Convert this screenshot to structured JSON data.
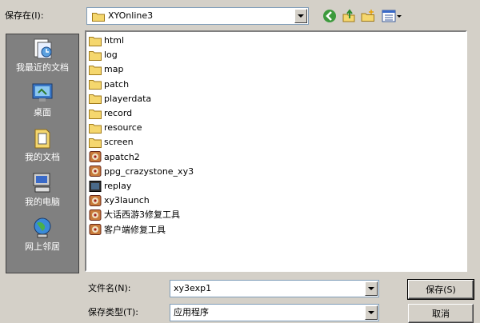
{
  "header": {
    "save_in_label": "保存在(I):",
    "current_folder": "XYOnline3"
  },
  "places": [
    {
      "label": "我最近的文档",
      "icon": "recent-documents-icon"
    },
    {
      "label": "桌面",
      "icon": "desktop-icon"
    },
    {
      "label": "我的文档",
      "icon": "my-documents-icon"
    },
    {
      "label": "我的电脑",
      "icon": "my-computer-icon"
    },
    {
      "label": "网上邻居",
      "icon": "network-places-icon"
    }
  ],
  "files": [
    {
      "name": "html",
      "kind": "folder"
    },
    {
      "name": "log",
      "kind": "folder"
    },
    {
      "name": "map",
      "kind": "folder"
    },
    {
      "name": "patch",
      "kind": "folder"
    },
    {
      "name": "playerdata",
      "kind": "folder"
    },
    {
      "name": "record",
      "kind": "folder"
    },
    {
      "name": "resource",
      "kind": "folder"
    },
    {
      "name": "screen",
      "kind": "folder"
    },
    {
      "name": "apatch2",
      "kind": "app"
    },
    {
      "name": "ppg_crazystone_xy3",
      "kind": "app"
    },
    {
      "name": "replay",
      "kind": "app-dark"
    },
    {
      "name": "xy3launch",
      "kind": "app"
    },
    {
      "name": "大话西游3修复工具",
      "kind": "app"
    },
    {
      "name": "客户端修复工具",
      "kind": "app"
    }
  ],
  "footer": {
    "filename_label": "文件名(N):",
    "filename_value": "xy3exp1",
    "filetype_label": "保存类型(T):",
    "filetype_value": "应用程序",
    "save_button": "保存(S)",
    "cancel_button": "取消"
  },
  "colors": {
    "dialog_bg": "#d4d0c8",
    "places_bg": "#808080",
    "folder_yellow": "#f5d76e"
  }
}
